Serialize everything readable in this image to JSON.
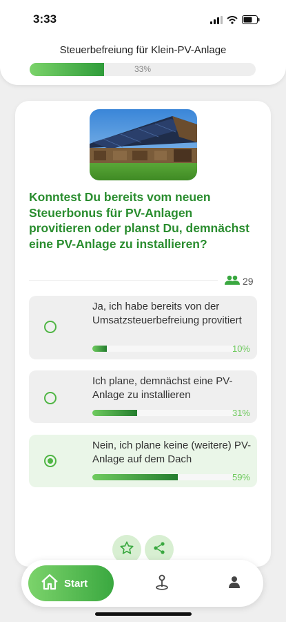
{
  "status": {
    "time": "3:33"
  },
  "header": {
    "title": "Steuerbefreiung für Klein-PV-Anlage",
    "progress_label": "33%",
    "progress_value": 0.33
  },
  "question": {
    "text": "Konntest Du bereits vom neuen Steuerbonus für PV-Anlagen provitieren oder planst Du, demnächst eine PV-Anlage zu installieren?",
    "votes": "29"
  },
  "options": [
    {
      "label": "Ja, ich habe bereits von der Umsatzsteuerbefreiung provitiert",
      "percent": "10%",
      "fraction": 0.1,
      "selected": false
    },
    {
      "label": "Ich plane, demnächst eine PV-Anlage zu installieren",
      "percent": "31%",
      "fraction": 0.31,
      "selected": false
    },
    {
      "label": "Nein, ich plane keine (weitere) PV-Anlage auf dem Dach",
      "percent": "59%",
      "fraction": 0.59,
      "selected": true
    }
  ],
  "tabs": {
    "start_label": "Start"
  },
  "icons": {
    "signal": "cellular-signal-icon",
    "wifi": "wifi-icon",
    "battery": "battery-icon",
    "votes": "people-icon",
    "star": "star-icon",
    "share": "share-icon",
    "home": "home-icon",
    "map": "map-pin-icon",
    "user": "user-icon"
  },
  "colors": {
    "accent": "#2a8d2f",
    "accent_light": "#6cc95b",
    "selected_bg": "#eaf6e8"
  }
}
